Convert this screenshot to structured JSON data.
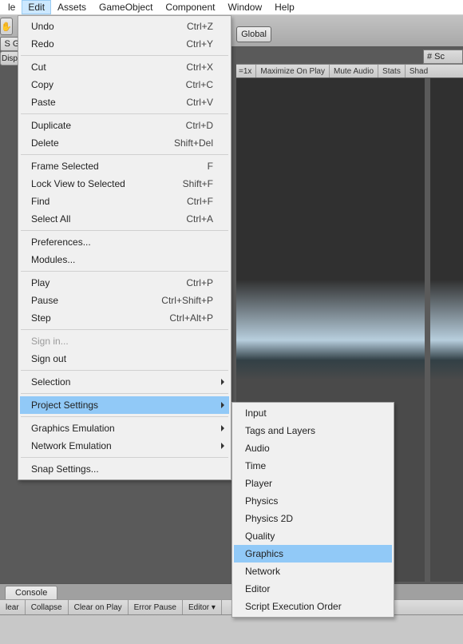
{
  "menubar": {
    "items": [
      "le",
      "Edit",
      "Assets",
      "GameObject",
      "Component",
      "Window",
      "Help"
    ],
    "active_index": 1
  },
  "toolbar": {
    "hand_icon": "✋",
    "sg_label": "S G",
    "disp_label": "Disp",
    "global_label": "Global"
  },
  "scene_tab": "# Sc",
  "right_row": {
    "scale_label": "1x",
    "maximize": "Maximize On Play",
    "mute": "Mute Audio",
    "stats": "Stats",
    "shad": "Shad"
  },
  "edit_menu": [
    {
      "type": "item",
      "label": "Undo",
      "shortcut": "Ctrl+Z"
    },
    {
      "type": "item",
      "label": "Redo",
      "shortcut": "Ctrl+Y"
    },
    {
      "type": "sep"
    },
    {
      "type": "item",
      "label": "Cut",
      "shortcut": "Ctrl+X"
    },
    {
      "type": "item",
      "label": "Copy",
      "shortcut": "Ctrl+C"
    },
    {
      "type": "item",
      "label": "Paste",
      "shortcut": "Ctrl+V"
    },
    {
      "type": "sep"
    },
    {
      "type": "item",
      "label": "Duplicate",
      "shortcut": "Ctrl+D"
    },
    {
      "type": "item",
      "label": "Delete",
      "shortcut": "Shift+Del"
    },
    {
      "type": "sep"
    },
    {
      "type": "item",
      "label": "Frame Selected",
      "shortcut": "F"
    },
    {
      "type": "item",
      "label": "Lock View to Selected",
      "shortcut": "Shift+F"
    },
    {
      "type": "item",
      "label": "Find",
      "shortcut": "Ctrl+F"
    },
    {
      "type": "item",
      "label": "Select All",
      "shortcut": "Ctrl+A"
    },
    {
      "type": "sep"
    },
    {
      "type": "item",
      "label": "Preferences..."
    },
    {
      "type": "item",
      "label": "Modules..."
    },
    {
      "type": "sep"
    },
    {
      "type": "item",
      "label": "Play",
      "shortcut": "Ctrl+P"
    },
    {
      "type": "item",
      "label": "Pause",
      "shortcut": "Ctrl+Shift+P"
    },
    {
      "type": "item",
      "label": "Step",
      "shortcut": "Ctrl+Alt+P"
    },
    {
      "type": "sep"
    },
    {
      "type": "item",
      "label": "Sign in...",
      "disabled": true
    },
    {
      "type": "item",
      "label": "Sign out"
    },
    {
      "type": "sep"
    },
    {
      "type": "item",
      "label": "Selection",
      "submenu": true
    },
    {
      "type": "sep"
    },
    {
      "type": "item",
      "label": "Project Settings",
      "submenu": true,
      "hl": true
    },
    {
      "type": "sep"
    },
    {
      "type": "item",
      "label": "Graphics Emulation",
      "submenu": true
    },
    {
      "type": "item",
      "label": "Network Emulation",
      "submenu": true
    },
    {
      "type": "sep"
    },
    {
      "type": "item",
      "label": "Snap Settings..."
    }
  ],
  "project_settings_submenu": [
    {
      "label": "Input"
    },
    {
      "label": "Tags and Layers"
    },
    {
      "label": "Audio"
    },
    {
      "label": "Time"
    },
    {
      "label": "Player"
    },
    {
      "label": "Physics"
    },
    {
      "label": "Physics 2D"
    },
    {
      "label": "Quality"
    },
    {
      "label": "Graphics",
      "hl": true
    },
    {
      "label": "Network"
    },
    {
      "label": "Editor"
    },
    {
      "label": "Script Execution Order"
    }
  ],
  "console": {
    "tab": "Console",
    "buttons": [
      "lear",
      "Collapse",
      "Clear on Play",
      "Error Pause",
      "Editor ▾"
    ]
  }
}
